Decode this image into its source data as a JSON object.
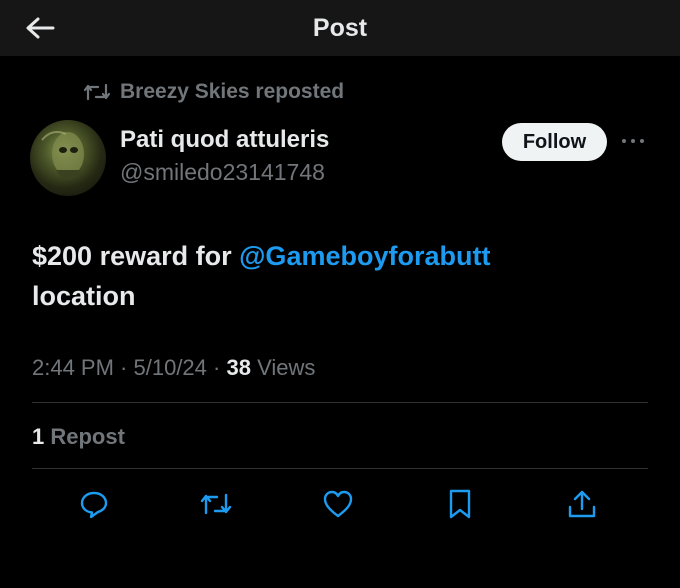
{
  "header": {
    "title": "Post",
    "back_icon": "arrow-left-icon"
  },
  "repost_banner": {
    "text": "Breezy Skies reposted",
    "icon": "repost-icon"
  },
  "author": {
    "name": "Pati quod attuleris",
    "handle": "@smiledo23141748"
  },
  "follow_button": {
    "label": "Follow"
  },
  "more_button": {
    "icon": "more-horizontal-icon"
  },
  "post": {
    "text_before": "$200 reward for ",
    "mention": "@Gameboyforabutt",
    "text_after": "location"
  },
  "meta": {
    "time": "2:44 PM",
    "sep1": " · ",
    "date": "5/10/24",
    "sep2": " · ",
    "views_count": "38",
    "views_label": " Views"
  },
  "stats": {
    "repost_count": "1",
    "repost_label": " Repost"
  },
  "actions": [
    "reply-icon",
    "repost-icon",
    "like-icon",
    "bookmark-icon",
    "share-icon"
  ],
  "colors": {
    "background": "#000000",
    "header": "#161616",
    "accent": "#1d9bf0",
    "muted": "#71767b",
    "text": "#e7e9ea"
  }
}
